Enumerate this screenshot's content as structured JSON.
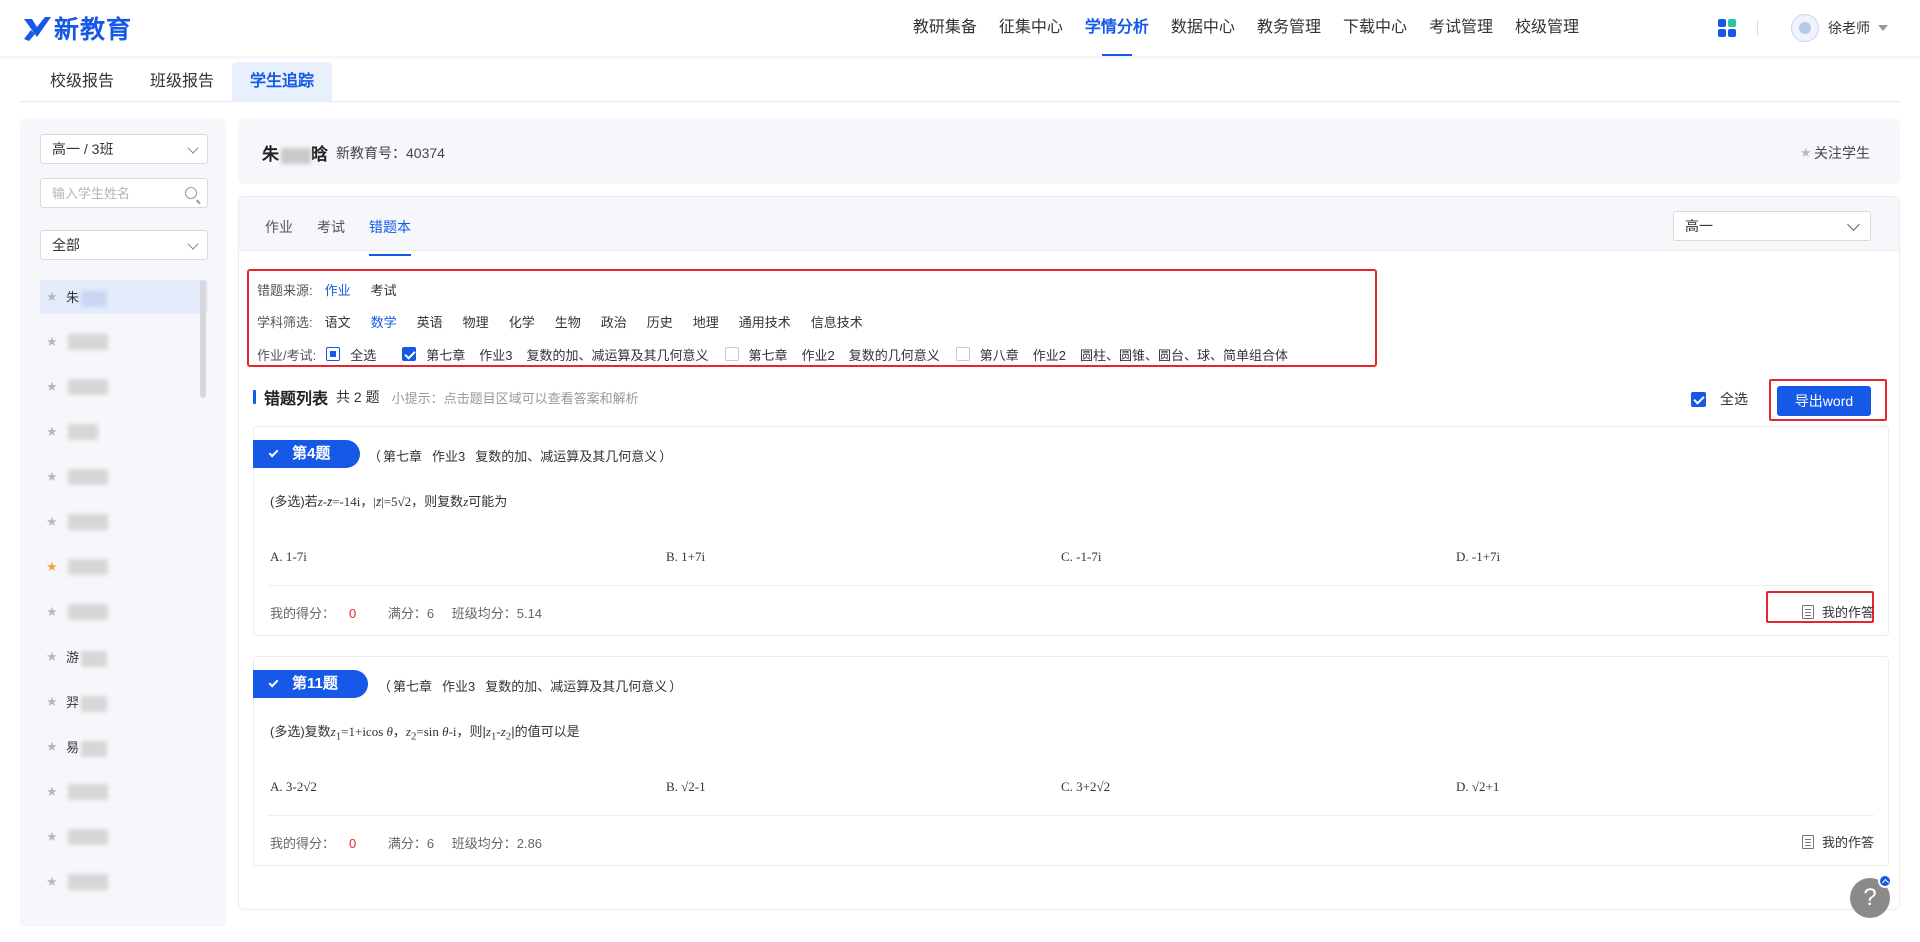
{
  "brand": {
    "name": "新教育",
    "color": "#1559e6"
  },
  "nav": {
    "items": [
      {
        "label": "教研集备",
        "active": false
      },
      {
        "label": "征集中心",
        "active": false
      },
      {
        "label": "学情分析",
        "active": true
      },
      {
        "label": "数据中心",
        "active": false
      },
      {
        "label": "教务管理",
        "active": false
      },
      {
        "label": "下载中心",
        "active": false
      },
      {
        "label": "考试管理",
        "active": false
      },
      {
        "label": "校级管理",
        "active": false
      }
    ],
    "apps_icon": "grid-apps-icon",
    "user_name": "徐老师"
  },
  "subtabs": [
    {
      "label": "校级报告",
      "active": false
    },
    {
      "label": "班级报告",
      "active": false
    },
    {
      "label": "学生追踪",
      "active": true
    }
  ],
  "sidebar": {
    "class_select": "高一 / 3班",
    "search_placeholder": "输入学生姓名",
    "filter_select": "全部",
    "students": [
      {
        "name": "朱",
        "starred": false,
        "active": true
      },
      {
        "name": "",
        "starred": false
      },
      {
        "name": "",
        "starred": false
      },
      {
        "name": "",
        "starred": false
      },
      {
        "name": "",
        "starred": false
      },
      {
        "name": "",
        "starred": false
      },
      {
        "name": "",
        "starred": true
      },
      {
        "name": "",
        "starred": false
      },
      {
        "name": "游",
        "starred": false
      },
      {
        "name": "羿",
        "starred": false
      },
      {
        "name": "易",
        "starred": false
      },
      {
        "name": "",
        "starred": false
      },
      {
        "name": "",
        "starred": false
      },
      {
        "name": "",
        "starred": false
      }
    ]
  },
  "student_header": {
    "name_first": "朱",
    "name_last": "晗",
    "id_label": "新教育号：40374",
    "follow_label": "关注学生"
  },
  "main": {
    "tabs": [
      {
        "label": "作业",
        "active": false
      },
      {
        "label": "考试",
        "active": false
      },
      {
        "label": "错题本",
        "active": true
      }
    ],
    "grade_select": "高一",
    "filters": {
      "source_label": "错题来源:",
      "sources": [
        {
          "label": "作业",
          "active": true
        },
        {
          "label": "考试",
          "active": false
        }
      ],
      "subject_label": "学科筛选:",
      "subjects": [
        {
          "label": "语文",
          "active": false
        },
        {
          "label": "数学",
          "active": true
        },
        {
          "label": "英语",
          "active": false
        },
        {
          "label": "物理",
          "active": false
        },
        {
          "label": "化学",
          "active": false
        },
        {
          "label": "生物",
          "active": false
        },
        {
          "label": "政治",
          "active": false
        },
        {
          "label": "历史",
          "active": false
        },
        {
          "label": "地理",
          "active": false
        },
        {
          "label": "通用技术",
          "active": false
        },
        {
          "label": "信息技术",
          "active": false
        }
      ],
      "assign_label": "作业/考试:",
      "select_all_label": "全选",
      "assignments": [
        {
          "chapter": "第七章",
          "hw": "作业3",
          "title": "复数的加、减运算及其几何意义",
          "checked": true
        },
        {
          "chapter": "第七章",
          "hw": "作业2",
          "title": "复数的几何意义",
          "checked": false
        },
        {
          "chapter": "第八章",
          "hw": "作业2",
          "title": "圆柱、圆锥、圆台、球、简单组合体",
          "checked": false
        }
      ]
    },
    "list": {
      "title": "错题列表",
      "count": "共 2 题",
      "tip": "小提示：点击题目区域可以查看答案和解析",
      "select_all": "全选",
      "export_label": "导出word"
    },
    "questions": [
      {
        "badge": "第4题",
        "source_open": "（",
        "source_chapter": "第七章",
        "source_hw": "作业3",
        "source_title": "复数的加、减运算及其几何意义",
        "source_close": "）",
        "options": [
          "A. 1-7i",
          "B. 1+7i",
          "C. -1-7i",
          "D. -1+7i"
        ],
        "score_label": "我的得分：",
        "score": "0",
        "full": "满分：6",
        "avg": "班级均分：5.14",
        "my_answer": "我的作答"
      },
      {
        "badge": "第11题",
        "source_open": "（",
        "source_chapter": "第七章",
        "source_hw": "作业3",
        "source_title": "复数的加、减运算及其几何意义",
        "source_close": "）",
        "score_label": "我的得分：",
        "score": "0",
        "full": "满分：6",
        "avg": "班级均分：2.86",
        "my_answer": "我的作答"
      }
    ]
  },
  "help_label": "?"
}
